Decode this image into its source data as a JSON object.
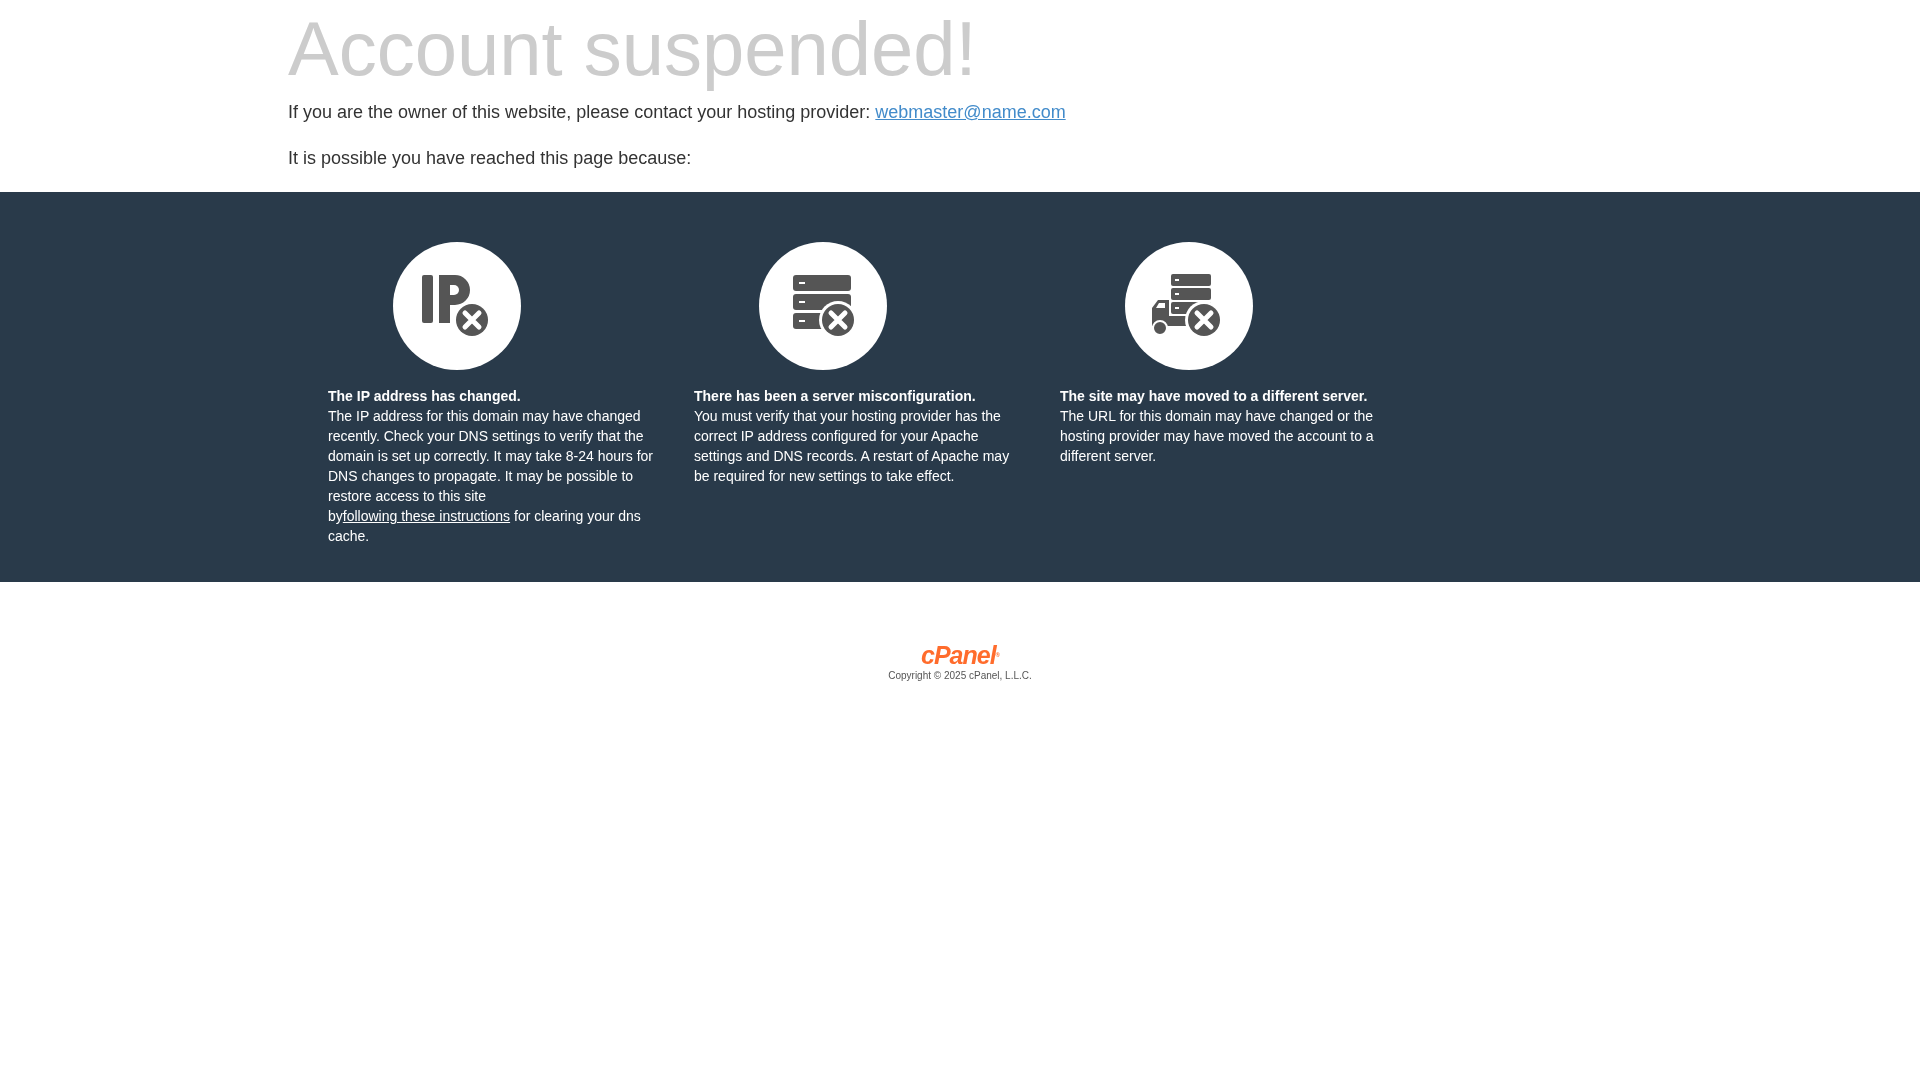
{
  "title": "Account suspended!",
  "contact": {
    "text": "If you are the owner of this website, please contact your hosting provider:",
    "link": "webmaster@name.com"
  },
  "reason_intro": "It is possible you have reached this page because:",
  "reasons": [
    {
      "kind": "ip",
      "heading": "The IP address has changed.",
      "text": "The IP address for this domain may have changed recently. Check your DNS settings to verify that the domain is set up correctly. It may take 8-24 hours for DNS changes to propagate. It may be possible to restore access to this site by",
      "link": "following these instructions",
      "text_after": "for clearing your dns cache."
    },
    {
      "kind": "server",
      "heading": "There has been a server misconfiguration.",
      "text": "You must verify that your hosting provider has the correct IP address configured for your Apache settings and DNS records. A restart of Apache may be required for new settings to take effect."
    },
    {
      "kind": "moved",
      "heading": "The site may have moved to a different server.",
      "text": "The URL for this domain may have changed or the hosting provider may have moved the account to a different server."
    }
  ],
  "footer": {
    "logo": "cPanel",
    "logo_mark": "®",
    "copyright": "Copyright © 2025 cPanel, L.L.C."
  }
}
